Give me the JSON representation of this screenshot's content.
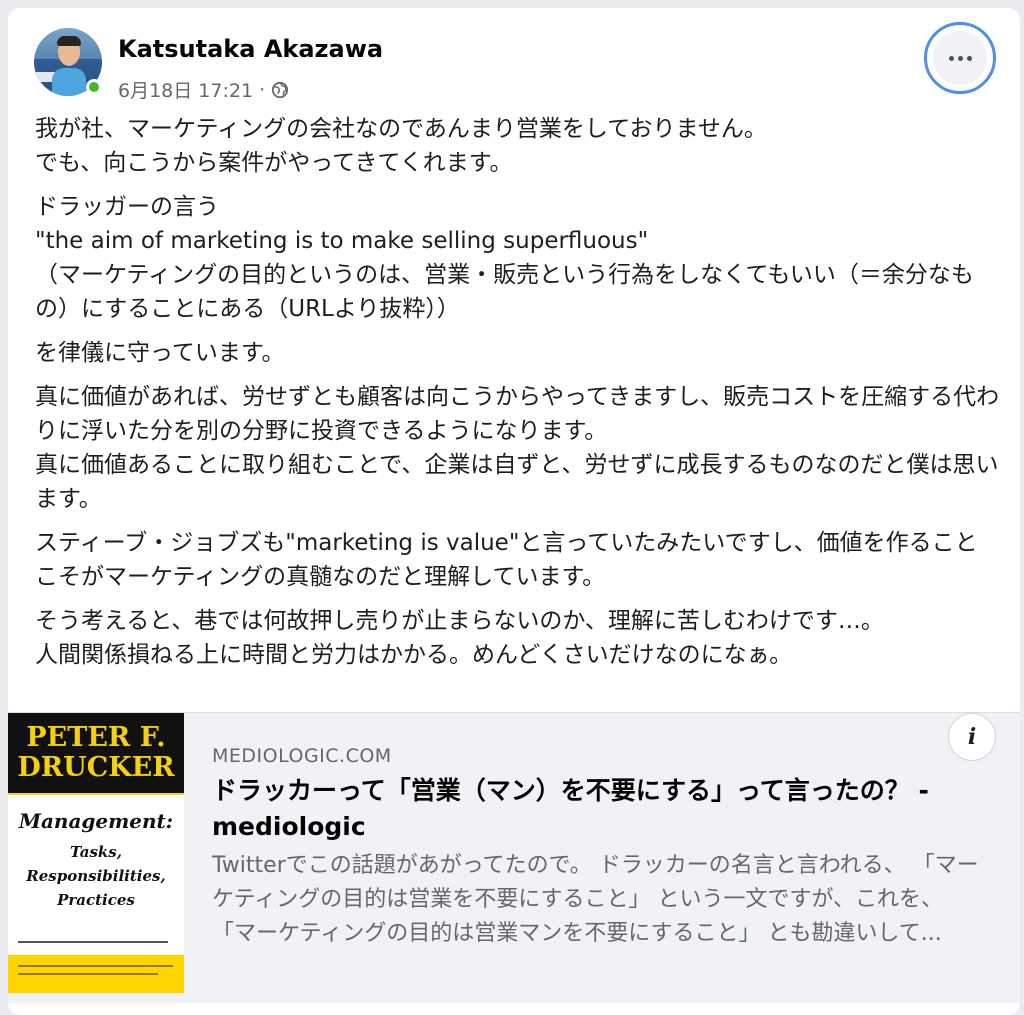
{
  "post": {
    "author": "Katsutaka Akazawa",
    "timestamp": "6月18日 17:21",
    "separator": "·",
    "privacy_icon": "globe-icon",
    "more_icon": "more-options-icon",
    "paragraphs": [
      "我が社、マーケティングの会社なのであんまり営業をしておりません。\nでも、向こうから案件がやってきてくれます。",
      "ドラッガーの言う\n\"the aim of marketing is to make selling superfluous\"\n（マーケティングの目的というのは、営業・販売という行為をしなくてもいい（＝余分なもの）にすることにある（URLより抜粋））",
      "を律儀に守っています。",
      "真に価値があれば、労せずとも顧客は向こうからやってきますし、販売コストを圧縮する代わりに浮いた分を別の分野に投資できるようになります。\n真に価値あることに取り組むことで、企業は自ずと、労せずに成長するものなのだと僕は思います。",
      "スティーブ・ジョブズも\"marketing is value\"と言っていたみたいですし、価値を作ることこそがマーケティングの真髄なのだと理解しています。",
      "そう考えると、巷では何故押し売りが止まらないのか、理解に苦しむわけです…。\n人間関係損ねる上に時間と労力はかかる。めんどくさいだけなのになぁ。"
    ]
  },
  "link_preview": {
    "domain": "MEDIOLOGIC.COM",
    "title": "ドラッカーって「営業（マン）を不要にする」って言ったの？ - mediologic",
    "description": "Twitterでこの話題があがってたので。 ドラッカーの名言と言われる、 「マーケティングの目的は営業を不要にすること」 という一文ですが、これを、 「マーケティングの目的は営業マンを不要にすること」 とも勘違いして...",
    "info_label": "i",
    "thumbnail": {
      "name_line1": "PETER F.",
      "name_line2": "DRUCKER",
      "book_title": "Management:",
      "subtitle_1": "Tasks,",
      "subtitle_2": "Responsibilities,",
      "subtitle_3": "Practices"
    }
  }
}
